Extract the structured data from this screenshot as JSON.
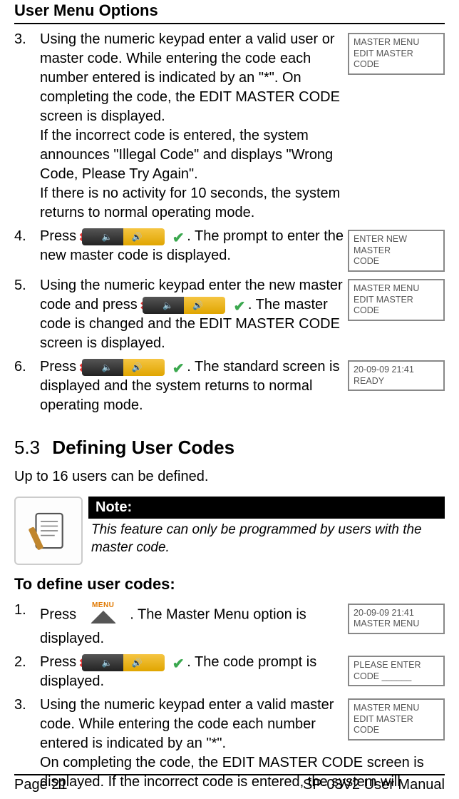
{
  "header": "User Menu Options",
  "items": {
    "i3": {
      "num": "3.",
      "p1": "Using the numeric keypad enter a valid user or master code. While entering the code each number entered is indicated by an \"*\". On completing the code, the EDIT MASTER CODE screen is displayed.",
      "p2": "If the incorrect code is entered, the system announces \"Illegal Code\" and displays \"Wrong Code, Please Try Again\".",
      "p3": "If there is no activity for 10 seconds, the system returns to normal operating mode.",
      "screen": {
        "l1": "MASTER MENU",
        "l2": "EDIT MASTER CODE"
      }
    },
    "i4": {
      "num": "4.",
      "pre": "Press ",
      "post": ". The prompt to enter the new master code is displayed.",
      "screen": {
        "l1": "ENTER NEW MASTER",
        "l2": "CODE"
      }
    },
    "i5": {
      "num": "5.",
      "pre": "Using the numeric keypad enter the new master code and press ",
      "post": ". The master code is changed and the EDIT MASTER CODE screen is displayed.",
      "screen": {
        "l1": "MASTER MENU",
        "l2": "EDIT MASTER CODE"
      }
    },
    "i6": {
      "num": "6.",
      "pre": "Press ",
      "post": ". The standard screen is displayed and the system returns to normal operating mode.",
      "screen": {
        "l1": "20-09-09  21:41",
        "l2": "READY"
      }
    }
  },
  "section": {
    "num": "5.3",
    "title": "Defining User Codes"
  },
  "intro": "Up to 16 users can be defined.",
  "note": {
    "head": "Note:",
    "body": "This feature can only be programmed by users with the master code."
  },
  "subhead": "To define user codes:",
  "def": {
    "d1": {
      "num": "1.",
      "pre": "Press ",
      "post": ". The Master Menu option is displayed.",
      "menu_label": "MENU",
      "screen": {
        "l1": "20-09-09 21:41",
        "l2": "MASTER MENU"
      }
    },
    "d2": {
      "num": "2.",
      "pre": "Press ",
      "post": ". The code prompt is displayed.",
      "screen": {
        "l1": "PLEASE ENTER",
        "l2": "CODE ______"
      }
    },
    "d3": {
      "num": "3.",
      "p1": "Using the numeric keypad enter a valid master code. While entering the code each number entered is indicated by an \"*\".",
      "p2": "On completing the code, the EDIT MASTER CODE screen is displayed. If the incorrect code is entered, the system will",
      "screen": {
        "l1": "MASTER MENU",
        "l2": "EDIT MASTER CODE"
      }
    }
  },
  "footer": {
    "left": "Page 21",
    "right": "SP-03V2 User Manual"
  }
}
